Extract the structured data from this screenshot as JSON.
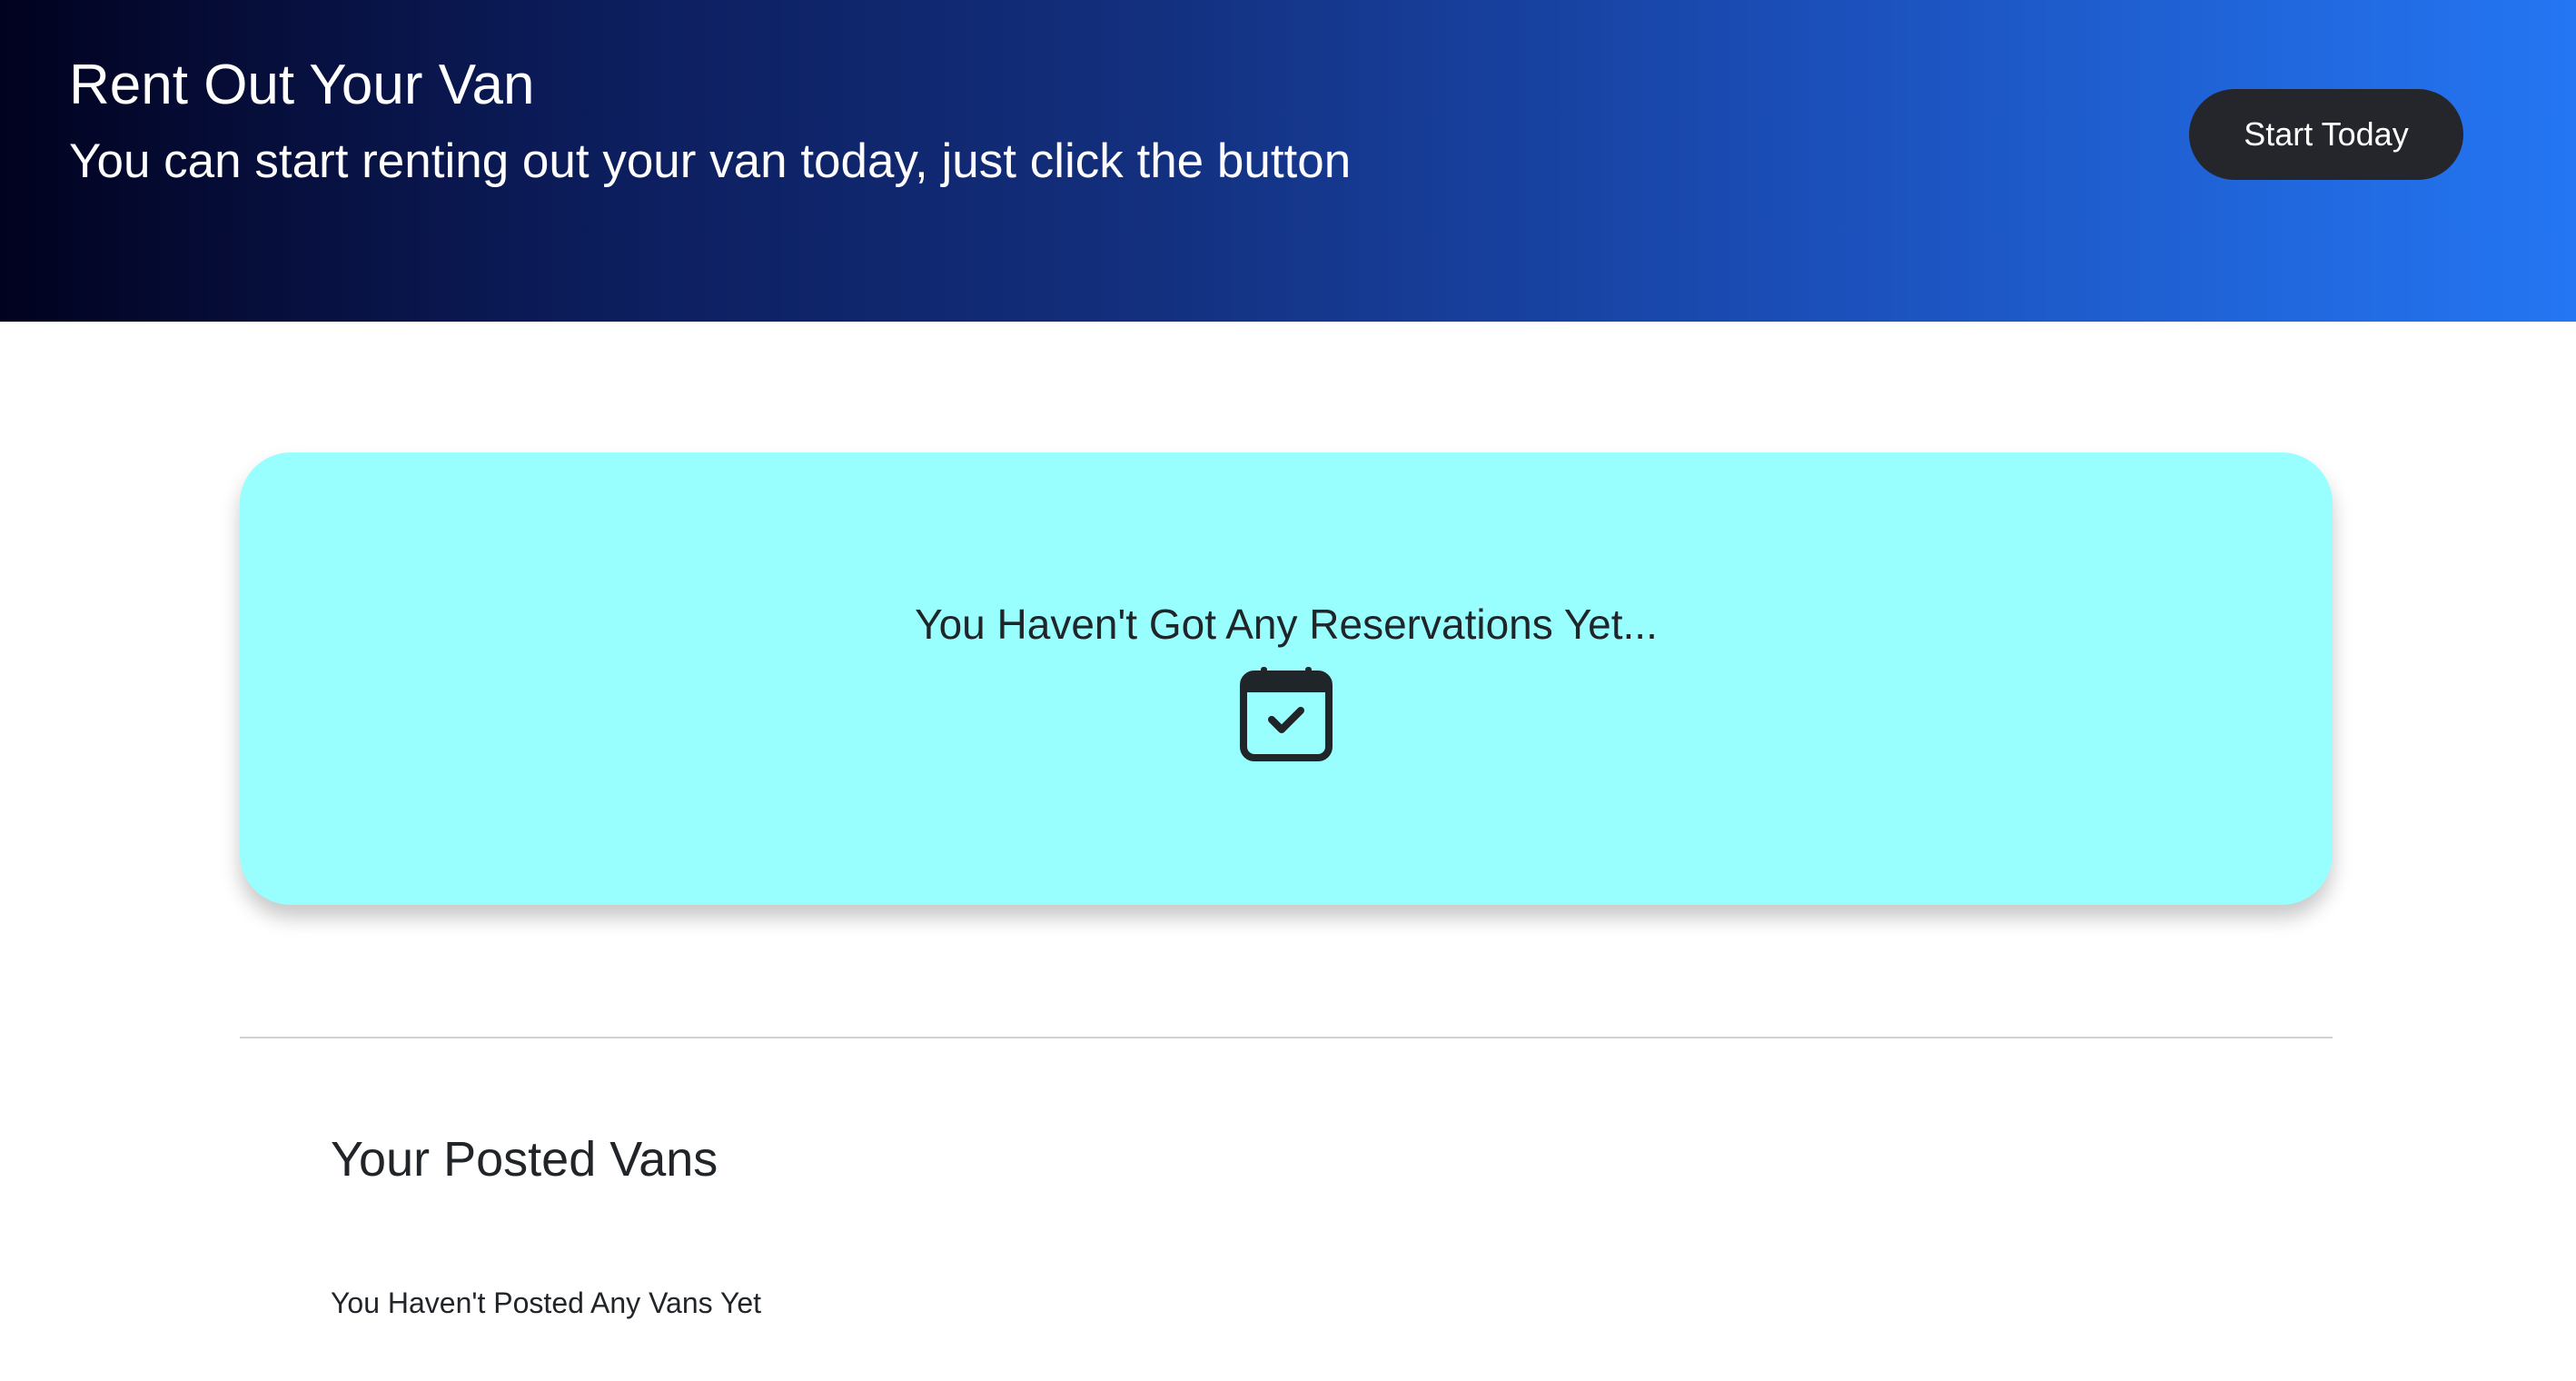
{
  "hero": {
    "title": "Rent Out Your Van",
    "subtitle": "You can start renting out your van today, just click the button",
    "button_label": "Start Today",
    "gradient_colors": [
      "#01021f",
      "#13307f",
      "#2476f3"
    ],
    "button_color": "#24262b"
  },
  "reservations": {
    "empty_message": "You Haven't Got Any Reservations Yet...",
    "icon": "calendar-check-icon",
    "card_color": "#98fffe"
  },
  "posted_vans": {
    "heading": "Your Posted Vans",
    "empty_message": "You Haven't Posted Any Vans Yet"
  }
}
